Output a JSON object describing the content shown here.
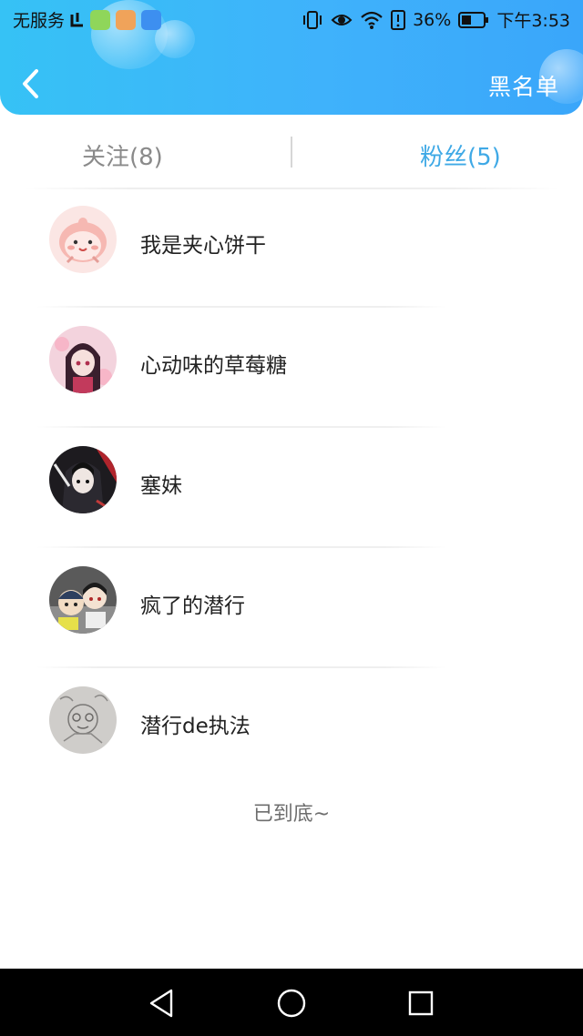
{
  "status_bar": {
    "carrier": "无服务",
    "battery": "36%",
    "time": "下午3:53"
  },
  "header": {
    "blacklist_label": "黑名单"
  },
  "tabs": [
    {
      "label": "关注(8)",
      "active": false
    },
    {
      "label": "粉丝(5)",
      "active": true
    }
  ],
  "fans": [
    {
      "name": "我是夹心饼干",
      "avatar_icon": "pink-mascot-avatar"
    },
    {
      "name": "心动味的草莓糖",
      "avatar_icon": "anime-girl-avatar"
    },
    {
      "name": "塞妹",
      "avatar_icon": "dark-anime-avatar"
    },
    {
      "name": "疯了的潜行",
      "avatar_icon": "chibi-duo-avatar"
    },
    {
      "name": "潜行de执法",
      "avatar_icon": "sketch-avatar"
    }
  ],
  "list_end_text": "已到底~",
  "colors": {
    "header_accent": "#3fb2fb",
    "active_tab": "#3fa9e6",
    "inactive_tab": "#8a8a8a"
  }
}
